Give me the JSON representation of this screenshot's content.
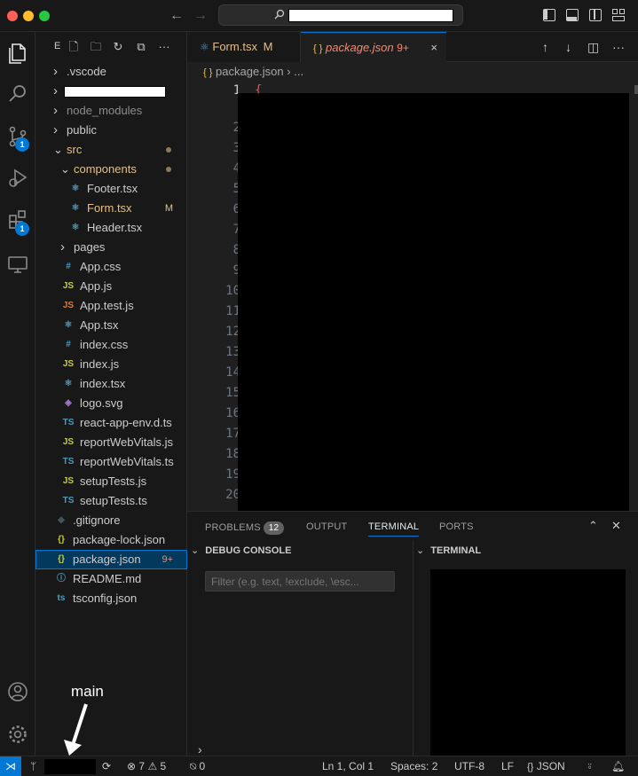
{
  "window": {
    "search_label": ""
  },
  "activity": {
    "source_control_badge": "1",
    "extensions_badge": "1"
  },
  "sidebar": {
    "header": "E",
    "tree": [
      {
        "label": ".vscode",
        "type": "folder",
        "state": "collapsed",
        "depth": 1
      },
      {
        "label": "",
        "type": "folder-redacted",
        "state": "collapsed",
        "depth": 1
      },
      {
        "label": "node_modules",
        "type": "folder",
        "state": "collapsed",
        "depth": 1,
        "dim": true
      },
      {
        "label": "public",
        "type": "folder",
        "state": "collapsed",
        "depth": 1
      },
      {
        "label": "src",
        "type": "folder",
        "state": "expanded",
        "depth": 1,
        "color": "#e2c08d",
        "dot": true
      },
      {
        "label": "components",
        "type": "folder",
        "state": "expanded",
        "depth": 2,
        "color": "#e2c08d",
        "dot": true
      },
      {
        "label": "Footer.tsx",
        "type": "react",
        "depth": 3
      },
      {
        "label": "Form.tsx",
        "type": "react",
        "depth": 3,
        "color": "#e2c08d",
        "deco": "M"
      },
      {
        "label": "Header.tsx",
        "type": "react",
        "depth": 3
      },
      {
        "label": "pages",
        "type": "folder",
        "state": "collapsed",
        "depth": 2
      },
      {
        "label": "App.css",
        "type": "css",
        "depth": 2
      },
      {
        "label": "App.js",
        "type": "js",
        "depth": 2
      },
      {
        "label": "App.test.js",
        "type": "test",
        "depth": 2
      },
      {
        "label": "App.tsx",
        "type": "react",
        "depth": 2
      },
      {
        "label": "index.css",
        "type": "css",
        "depth": 2
      },
      {
        "label": "index.js",
        "type": "js",
        "depth": 2
      },
      {
        "label": "index.tsx",
        "type": "react",
        "depth": 2
      },
      {
        "label": "logo.svg",
        "type": "svg",
        "depth": 2
      },
      {
        "label": "react-app-env.d.ts",
        "type": "ts",
        "depth": 2
      },
      {
        "label": "reportWebVitals.js",
        "type": "js",
        "depth": 2
      },
      {
        "label": "reportWebVitals.ts",
        "type": "ts",
        "depth": 2
      },
      {
        "label": "setupTests.js",
        "type": "js",
        "depth": 2
      },
      {
        "label": "setupTests.ts",
        "type": "ts",
        "depth": 2
      },
      {
        "label": ".gitignore",
        "type": "git",
        "depth": 1
      },
      {
        "label": "package-lock.json",
        "type": "json",
        "depth": 1
      },
      {
        "label": "package.json",
        "type": "json",
        "depth": 1,
        "selected": true,
        "deco": "9+"
      },
      {
        "label": "README.md",
        "type": "info",
        "depth": 1
      },
      {
        "label": "tsconfig.json",
        "type": "tsconfig",
        "depth": 1
      }
    ]
  },
  "tabs": [
    {
      "label": "Form.tsx",
      "mod": "M"
    },
    {
      "label": "package.json",
      "mod": "9+",
      "close": "×"
    }
  ],
  "breadcrumb": {
    "icon": "{ }",
    "file": "package.json",
    "sep": "›",
    "more": "..."
  },
  "editor": {
    "line_numbers": [
      "1",
      "2",
      "3",
      "4",
      "5",
      "6",
      "7",
      "8",
      "9",
      "10",
      "11",
      "12",
      "13",
      "14",
      "15",
      "16",
      "17",
      "18",
      "19",
      "20"
    ],
    "first_char": "{"
  },
  "panel": {
    "tabs": [
      "PROBLEMS",
      "OUTPUT",
      "TERMINAL",
      "PORTS"
    ],
    "problems_count": "12",
    "debug_console_title": "DEBUG CONSOLE",
    "terminal_title": "TERMINAL",
    "filter_placeholder": "Filter (e.g. text, !exclude, \\esc...",
    "prompt": "›"
  },
  "statusbar": {
    "errors": "7",
    "warnings": "5",
    "ports": "0",
    "position": "Ln 1, Col 1",
    "spaces": "Spaces: 2",
    "encoding": "UTF-8",
    "eol": "LF",
    "language": "JSON"
  },
  "annotation": {
    "text": "main"
  },
  "colors": {
    "accent": "#0078d4",
    "modified": "#e2c08d",
    "error_tab": "#f48771"
  }
}
